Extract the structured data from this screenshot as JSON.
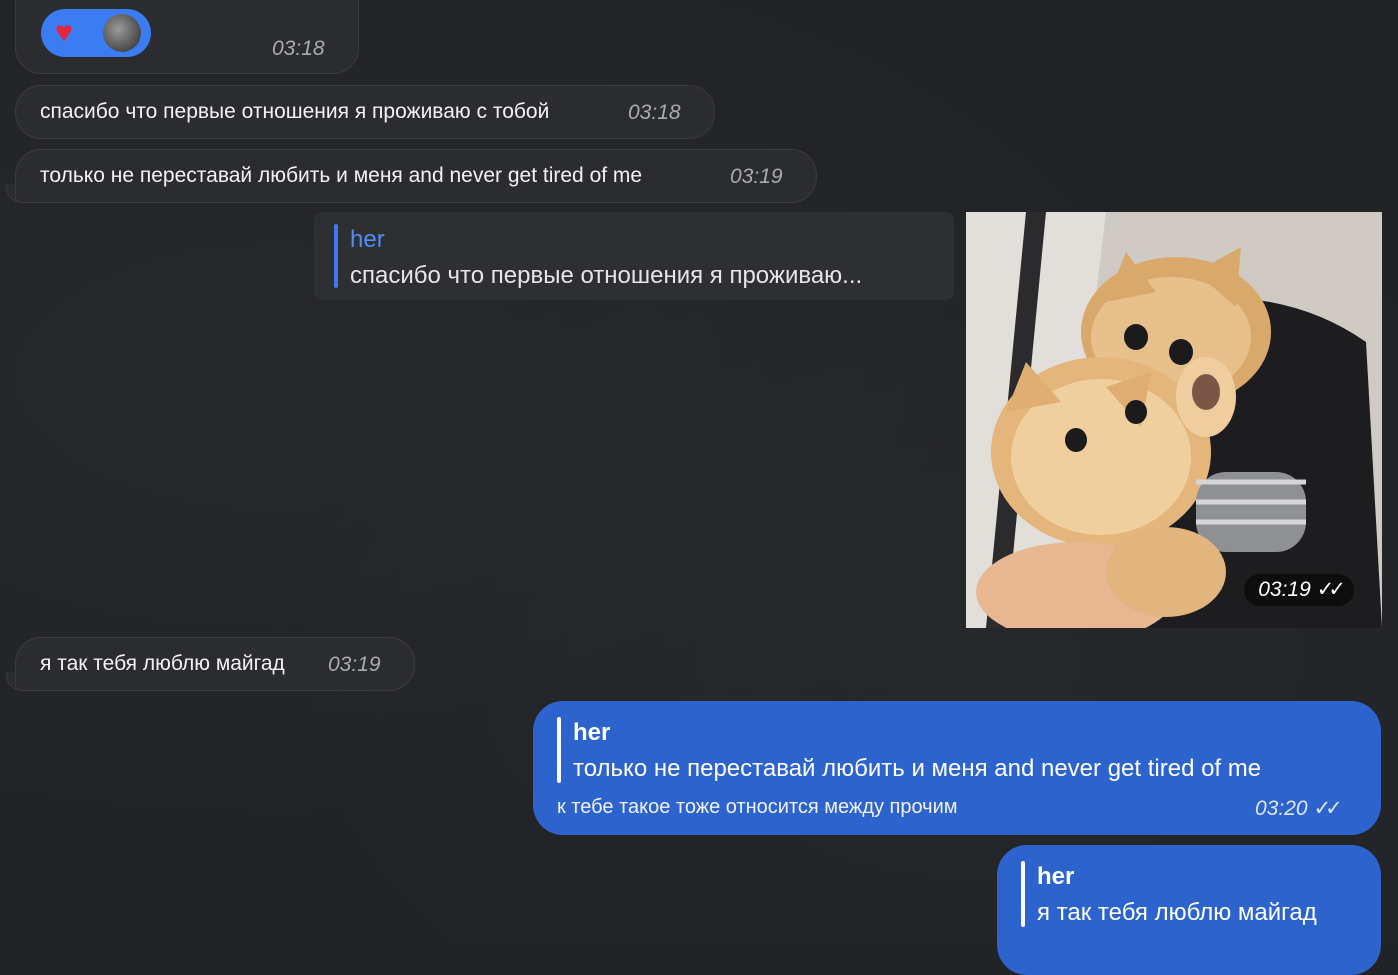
{
  "messages": {
    "m1": {
      "time": "03:18",
      "reaction": {
        "emoji": "♥",
        "icon": "heart-icon",
        "color": "#e8243a"
      }
    },
    "m2": {
      "text": "спасибо что первые отношения я проживаю с тобой",
      "time": "03:18"
    },
    "m3": {
      "text": "только не переставай любить и меня and never get tired of me",
      "time": "03:19"
    },
    "m4": {
      "reply_author": "her",
      "reply_text": "спасибо что первые отношения я проживаю...",
      "time": "03:19",
      "status": "✓✓"
    },
    "m5": {
      "text": "я так тебя люблю майгад",
      "time": "03:19"
    },
    "m6": {
      "reply_author": "her",
      "reply_text": "только не переставай любить и меня and never get tired of me",
      "text": "к тебе такое тоже относится между прочим",
      "time": "03:20",
      "status": "✓✓"
    },
    "m7": {
      "reply_author": "her",
      "reply_text": "я так тебя люблю майгад"
    }
  },
  "colors": {
    "background": "#212327",
    "incoming": "#2b2c30",
    "outgoing": "#2c63cc",
    "reply_accent": "#3b7cf3"
  }
}
